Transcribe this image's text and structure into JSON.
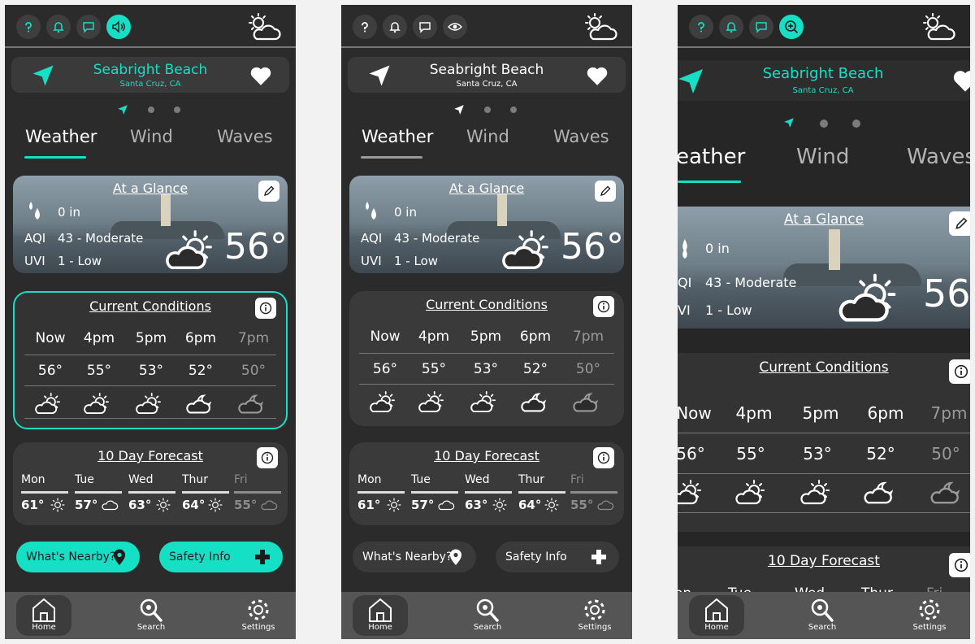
{
  "location": {
    "name": "Seabright Beach",
    "sub": "Santa Cruz, CA"
  },
  "tabs": [
    "Weather",
    "Wind",
    "Waves"
  ],
  "tabs_cropped": [
    "eather",
    "Wind",
    "Waves"
  ],
  "glance": {
    "title": "At a Glance",
    "rain": "0 in",
    "aqi_label": "AQI",
    "aqi_value": "43 - Moderate",
    "uvi_label": "UVI",
    "uvi_value": "1 - Low",
    "aqi_label_cropped": "QI",
    "uvi_label_cropped": "VI",
    "temp": "56°",
    "temp_cropped": "56"
  },
  "current": {
    "title": "Current Conditions",
    "hours": [
      "Now",
      "4pm",
      "5pm",
      "6pm",
      "7pm"
    ],
    "hours_cropped": [
      "Now",
      "4pm",
      "5pm",
      "6pm",
      "7pm"
    ],
    "temps": [
      "56°",
      "55°",
      "53°",
      "52°",
      "50°"
    ],
    "icons": [
      "partly-sunny-icon",
      "partly-sunny-icon",
      "partly-sunny-icon",
      "moon-cloud-icon",
      "moon-cloud-icon"
    ]
  },
  "forecast": {
    "title": "10 Day Forecast",
    "days": [
      "Mon",
      "Tue",
      "Wed",
      "Thur",
      "Fri"
    ],
    "temps": [
      "61°",
      "57°",
      "63°",
      "64°",
      "55°"
    ],
    "icons": [
      "sun-icon",
      "cloud-icon",
      "sun-icon",
      "sun-icon",
      "cloud-icon"
    ],
    "cropped_days": [
      "on",
      "Tue",
      "Wed",
      "Thur",
      "Fri"
    ]
  },
  "buttons": {
    "nearby": "What's Nearby?",
    "safety": "Safety Info"
  },
  "nav": {
    "home": "Home",
    "search": "Search",
    "settings": "Settings"
  },
  "colors": {
    "accent": "#15e0c6",
    "background": "#2b2b2b",
    "card": "#3a3a3a"
  }
}
